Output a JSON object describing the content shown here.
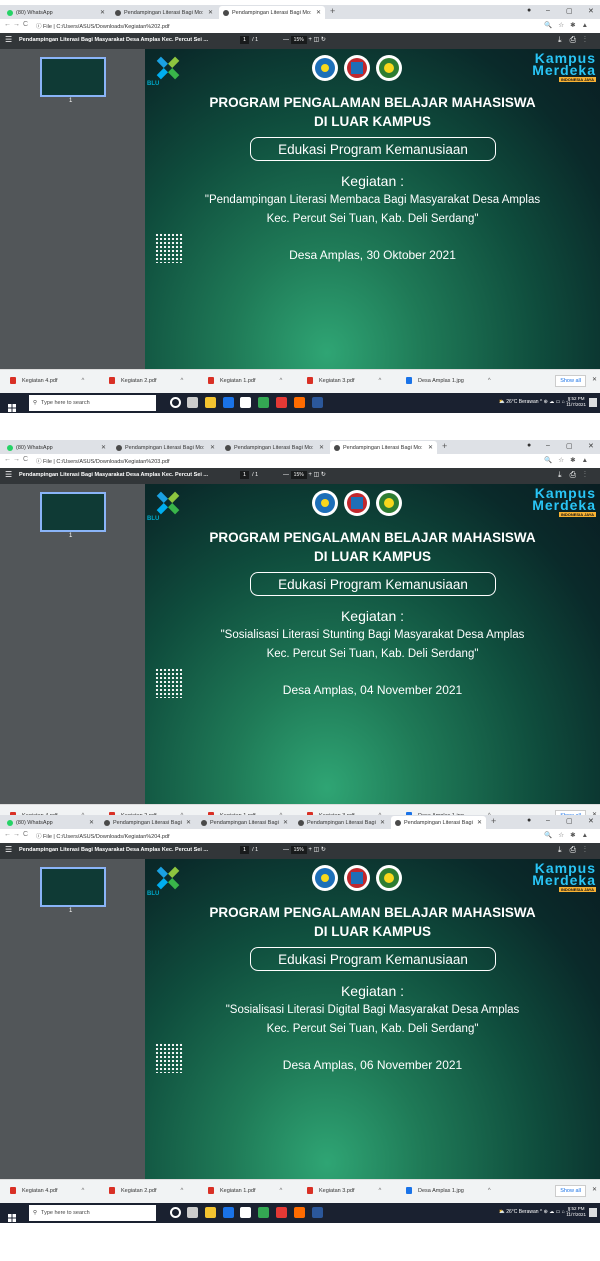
{
  "colors": {
    "accent": "#8ab4f8",
    "brand_green": "#1f7a57",
    "kampus_blue": "#29c5f6"
  },
  "screenshots": [
    {
      "tabs": [
        {
          "label": "(80) WhatsApp",
          "favicon": "whatsapp-icon",
          "active": false
        },
        {
          "label": "Pendampingan Literasi Bagi Mo:",
          "favicon": "chrome-icon",
          "active": false
        },
        {
          "label": "Pendampingan Literasi Bagi Mo:",
          "favicon": "chrome-icon",
          "active": true
        }
      ],
      "url": "C:/Users/ASUS/Downloads/Kegiatan%202.pdf",
      "address_prefix": "File",
      "pdf_title": "Pendampingan Literasi Bagi Masyarakat Desa Amplas Kec. Percut Sei ...",
      "page_current": "1",
      "page_total": "/ 1",
      "zoom": "15%",
      "thumb_number": "1",
      "slide": {
        "program_line1": "PROGRAM PENGALAMAN BELAJAR MAHASISWA",
        "program_line2": "DI LUAR KAMPUS",
        "edu_label": "Edukasi Program Kemanusiaan",
        "kegiatan": "Kegiatan :",
        "desc_line1": "\"Pendampingan Literasi Membaca Bagi Masyarakat Desa Amplas",
        "desc_line2": "Kec. Percut Sei Tuan, Kab. Deli Serdang\"",
        "date": "Desa Amplas, 30 Oktober 2021",
        "kampus_line1": "Kampus",
        "kampus_line2": "Merdeka",
        "kampus_sub": "INDONESIA JAYA",
        "blu_text": "BLU"
      }
    },
    {
      "tabs": [
        {
          "label": "(80) WhatsApp",
          "favicon": "whatsapp-icon",
          "active": false
        },
        {
          "label": "Pendampingan Literasi Bagi Mo:",
          "favicon": "chrome-icon",
          "active": false
        },
        {
          "label": "Pendampingan Literasi Bagi Mo:",
          "favicon": "chrome-icon",
          "active": false
        },
        {
          "label": "Pendampingan Literasi Bagi Mo:",
          "favicon": "chrome-icon",
          "active": true
        }
      ],
      "url": "C:/Users/ASUS/Downloads/Kegiatan%203.pdf",
      "address_prefix": "File",
      "pdf_title": "Pendampingan Literasi Bagi Masyarakat Desa Amplas Kec. Percut Sei ...",
      "page_current": "1",
      "page_total": "/ 1",
      "zoom": "15%",
      "thumb_number": "1",
      "slide": {
        "program_line1": "PROGRAM PENGALAMAN BELAJAR MAHASISWA",
        "program_line2": "DI LUAR KAMPUS",
        "edu_label": "Edukasi Program Kemanusiaan",
        "kegiatan": "Kegiatan :",
        "desc_line1": "\"Sosialisasi Literasi Stunting Bagi Masyarakat Desa Amplas",
        "desc_line2": "Kec. Percut Sei Tuan, Kab. Deli Serdang\"",
        "date": "Desa Amplas, 04 November 2021",
        "kampus_line1": "Kampus",
        "kampus_line2": "Merdeka",
        "kampus_sub": "INDONESIA JAYA",
        "blu_text": "BLU"
      }
    },
    {
      "tabs": [
        {
          "label": "(80) WhatsApp",
          "favicon": "whatsapp-icon",
          "active": false
        },
        {
          "label": "Pendampingan Literasi Bagi",
          "favicon": "chrome-icon",
          "active": false
        },
        {
          "label": "Pendampingan Literasi Bagi",
          "favicon": "chrome-icon",
          "active": false
        },
        {
          "label": "Pendampingan Literasi Bagi",
          "favicon": "chrome-icon",
          "active": false
        },
        {
          "label": "Pendampingan Literasi Bagi",
          "favicon": "chrome-icon",
          "active": true
        }
      ],
      "url": "C:/Users/ASUS/Downloads/Kegiatan%204.pdf",
      "address_prefix": "File",
      "pdf_title": "Pendampingan Literasi Bagi Masyarakat Desa Amplas Kec. Percut Sei ...",
      "page_current": "1",
      "page_total": "/ 1",
      "zoom": "15%",
      "thumb_number": "1",
      "slide": {
        "program_line1": "PROGRAM PENGALAMAN BELAJAR MAHASISWA",
        "program_line2": "DI LUAR KAMPUS",
        "edu_label": "Edukasi Program Kemanusiaan",
        "kegiatan": "Kegiatan :",
        "desc_line1": "\"Sosialisasi Literasi Digital Bagi Masyarakat Desa Amplas",
        "desc_line2": "Kec. Percut Sei Tuan, Kab. Deli Serdang\"",
        "date": "Desa Amplas, 06 November 2021",
        "kampus_line1": "Kampus",
        "kampus_line2": "Merdeka",
        "kampus_sub": "INDONESIA JAYA",
        "blu_text": "BLU"
      }
    }
  ],
  "downloads": [
    {
      "label": "Kegiatan 4.pdf",
      "type": "pdf"
    },
    {
      "label": "Kegiatan 2.pdf",
      "type": "pdf"
    },
    {
      "label": "Kegiatan 1.pdf",
      "type": "pdf"
    },
    {
      "label": "Kegiatan 3.pdf",
      "type": "pdf"
    },
    {
      "label": "Desa Amplas 1.jpg",
      "type": "jpg"
    }
  ],
  "show_all": "Show all",
  "taskbar": {
    "search_placeholder": "Type here to search",
    "weather": "26°C Berawan",
    "time": "9:52 PM",
    "date": "11/7/2021"
  }
}
